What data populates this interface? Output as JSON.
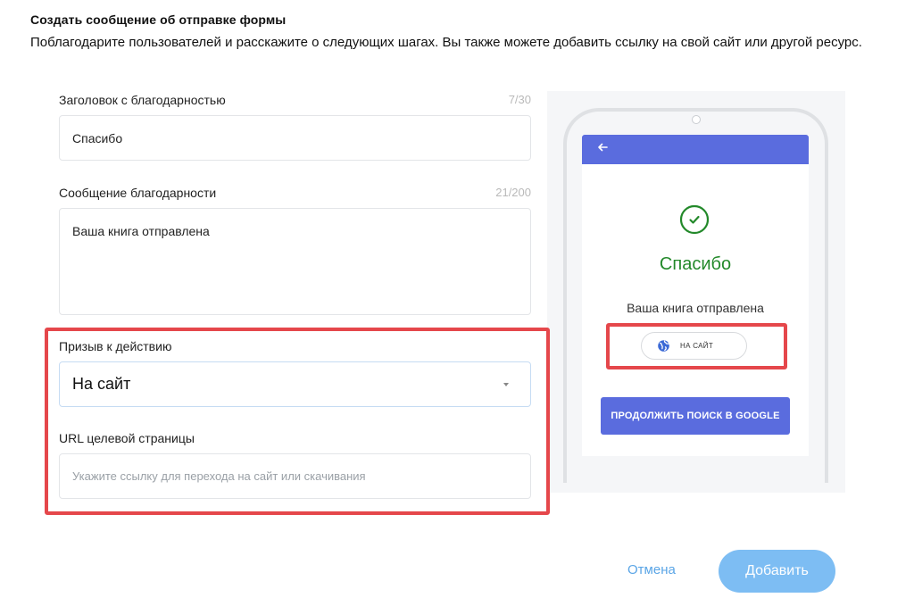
{
  "section": {
    "title": "Создать сообщение об отправке формы",
    "description": "Поблагодарите пользователей и расскажите о следующих шагах. Вы также можете добавить ссылку на свой сайт или другой ресурс."
  },
  "form": {
    "thanks_title": {
      "label": "Заголовок с благодарностью",
      "counter": "7/30",
      "value": "Спасибо"
    },
    "thanks_message": {
      "label": "Сообщение благодарности",
      "counter": "21/200",
      "value": "Ваша книга отправлена"
    },
    "cta": {
      "label": "Призыв к действию",
      "selected": "На сайт"
    },
    "url": {
      "label": "URL целевой страницы",
      "placeholder": "Укажите ссылку для перехода на сайт или скачивания"
    }
  },
  "preview": {
    "back_icon": "arrow-left",
    "title": "Спасибо",
    "message": "Ваша книга отправлена",
    "cta_label": "НА САЙТ",
    "continue_label": "ПРОДОЛЖИТЬ ПОИСК В GOOGLE"
  },
  "footer": {
    "cancel_label": "Отмена",
    "add_label": "Добавить"
  },
  "colors": {
    "accent": "#5a6cde",
    "success": "#23892a",
    "highlight": "#e5474b",
    "link": "#5aa5e6",
    "primary_button": "#7dbdf3"
  }
}
